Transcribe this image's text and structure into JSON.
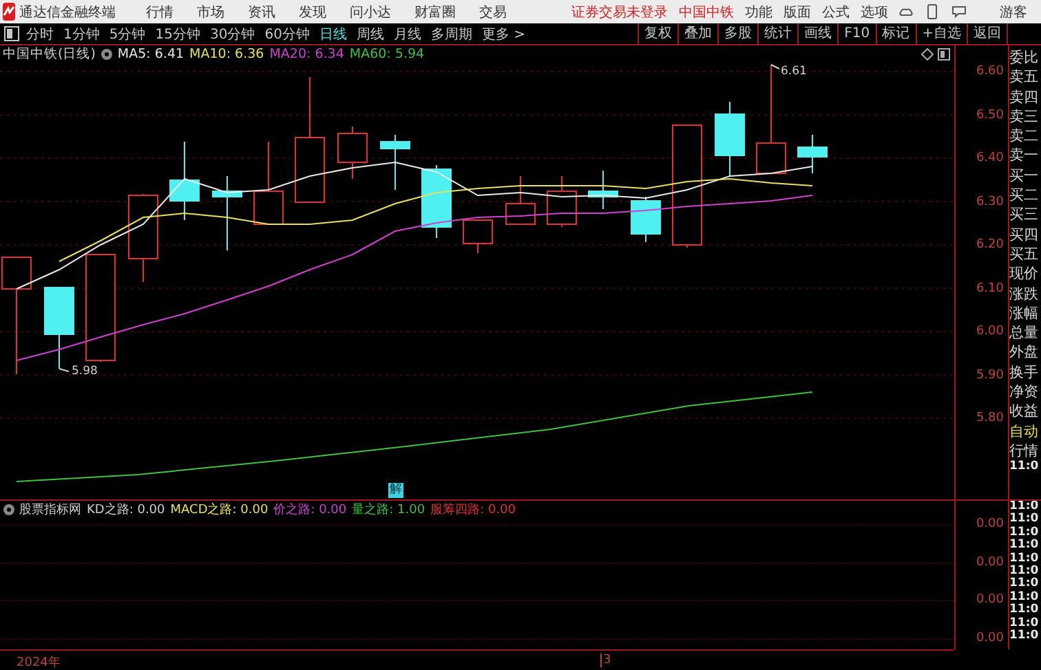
{
  "app_bar": {
    "title": "通达信金融终端",
    "menu": [
      "行情",
      "市场",
      "资讯",
      "发现",
      "问小达",
      "财富圈",
      "交易"
    ],
    "login_notice": "证券交易未登录",
    "stock_name": "中国中铁",
    "right_menu": [
      "功能",
      "版面",
      "公式",
      "选项"
    ],
    "user": "游客"
  },
  "period_tabs": [
    {
      "label": "分时",
      "selected": false
    },
    {
      "label": "1分钟",
      "selected": false
    },
    {
      "label": "5分钟",
      "selected": false
    },
    {
      "label": "15分钟",
      "selected": false
    },
    {
      "label": "30分钟",
      "selected": false
    },
    {
      "label": "60分钟",
      "selected": false
    },
    {
      "label": "日线",
      "selected": true
    },
    {
      "label": "周线",
      "selected": false
    },
    {
      "label": "月线",
      "selected": false
    },
    {
      "label": "多周期",
      "selected": false
    },
    {
      "label": "更多 >",
      "selected": false
    }
  ],
  "tools": [
    "复权",
    "叠加",
    "多股",
    "统计",
    "画线",
    "F10",
    "标记",
    "+自选",
    "返回"
  ],
  "chart": {
    "title": "中国中铁(日线)",
    "ma": [
      {
        "label": "MA5: 6.41",
        "color": "#e8e8e8"
      },
      {
        "label": "MA10: 6.36",
        "color": "#e8e060"
      },
      {
        "label": "MA20: 6.34",
        "color": "#d040d0"
      },
      {
        "label": "MA60: 5.94",
        "color": "#40c040"
      }
    ],
    "high_label": "6.61",
    "low_label": "5.98",
    "marker": "解",
    "price_axis": [
      "6.60",
      "6.50",
      "6.40",
      "6.30",
      "6.20",
      "6.10",
      "6.00",
      "5.90",
      "5.80"
    ]
  },
  "indicator": {
    "name": "股票指标网",
    "lines": [
      {
        "label": "KD之路: 0.00",
        "color": "#d0d0d0"
      },
      {
        "label": "MACD之路: 0.00",
        "color": "#e8e060"
      },
      {
        "label": "价之路: 0.00",
        "color": "#d040d0"
      },
      {
        "label": "量之路: 1.00",
        "color": "#40c040"
      },
      {
        "label": "服筹四路: 0.00",
        "color": "#e03030"
      }
    ],
    "axis": [
      "0.00",
      "0.00",
      "0.00",
      "0.00"
    ]
  },
  "time_axis": [
    "2024年",
    "3"
  ],
  "quote_panel": {
    "labels": [
      "委比",
      "卖五",
      "卖四",
      "卖三",
      "卖二",
      "卖一",
      "买一",
      "买二",
      "买三",
      "买四",
      "买五",
      "现价",
      "涨跌",
      "涨幅",
      "总量",
      "外盘",
      "换手",
      "净资",
      "收益"
    ],
    "auto": "自动",
    "market": "行情",
    "times": [
      "11:0",
      "11:0",
      "11:0",
      "11:0",
      "11:0",
      "11:0",
      "11:0",
      "11:0",
      "11:0",
      "11:0",
      "11:0",
      "11:0"
    ]
  }
}
